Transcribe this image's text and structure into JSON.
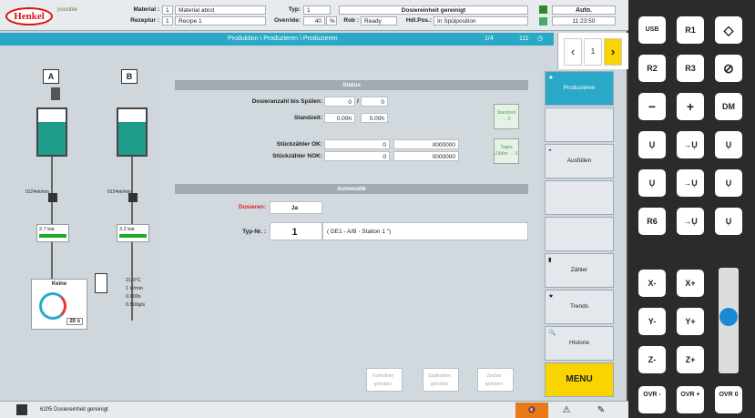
{
  "header": {
    "logo": "Henkel",
    "subbrand": "possible",
    "material_label": "Material :",
    "material_no": "1",
    "material_name": "Material abcd",
    "recipe_label": "Rezeptur :",
    "recipe_no": "1",
    "recipe_name": "Recipe 1",
    "typ_label": "Typ:",
    "typ_value": "1",
    "override_label": "Override:",
    "override_value": "40",
    "override_unit": "%",
    "rob_label": "Rob :",
    "rob_value": "Ready",
    "hdl_label": "Hdl.Pos.:",
    "hdl_value": "In Spülposition",
    "status_text": "Dosiereinheit gereinigt",
    "mode": "Auto.",
    "time": "11:23:50"
  },
  "breadcrumb": {
    "path": "Produktion \\ Produzieren \\ Produzieren",
    "page": "1/4",
    "count": "111"
  },
  "pager": {
    "value": "1"
  },
  "left": {
    "tank_a": "A",
    "tank_b": "B",
    "flow_a": "0124ml/min",
    "flow_b": "0124ml/min",
    "pressure_a": "2.7",
    "pressure_b": "3.2",
    "pressure_unit": "bar",
    "temp": "21.0°C",
    "rate1": "1 U/min",
    "rate2": "0.000s",
    "rate3": "0.500g/s",
    "gauge_label": "Keine",
    "gauge_value": "20 s"
  },
  "status": {
    "title": "Status",
    "dos_label": "Dosieranzahl bis Spülen:",
    "dos_val1": "0",
    "dos_sep": "/",
    "dos_val2": "0",
    "stand_label": "Standzeit:",
    "stand_val1": "0.00h",
    "stand_val2": "0.00h",
    "ok_label": "Stückzähler OK:",
    "ok_val1": "0",
    "ok_val2": "0000000",
    "nok_label": "Stückzähler NOK:",
    "nok_val1": "0",
    "nok_val2": "0000000",
    "btn1": "Standzeit → 0",
    "btn2": "Tages Zähler → 0"
  },
  "auto": {
    "title": "Automatik",
    "dos_label": "Dosieren:",
    "dos_value": "Ja",
    "typ_label": "Typ-Nr. :",
    "typ_value": "1",
    "typ_desc": "( DE1 - A/B - Station 1 \")"
  },
  "bottom_buttons": [
    "Fußkolben gehoben",
    "Spülkolben gehoben",
    "Zeuber gehoben"
  ],
  "side_menu": [
    "Produzieren",
    "",
    "Ausfüllen",
    "",
    "",
    "Zähler",
    "Trends",
    "Historie",
    "MENU"
  ],
  "footer": {
    "msg": "6205 Dosiereinheit gereinigt"
  },
  "keys": [
    "USB",
    "R1",
    "R2",
    "R3",
    "−",
    "+",
    "DM",
    "R6",
    "X-",
    "X+",
    "Y-",
    "Y+",
    "Z-",
    "Z+",
    "OVR -",
    "OVR +",
    "OVR 0"
  ]
}
